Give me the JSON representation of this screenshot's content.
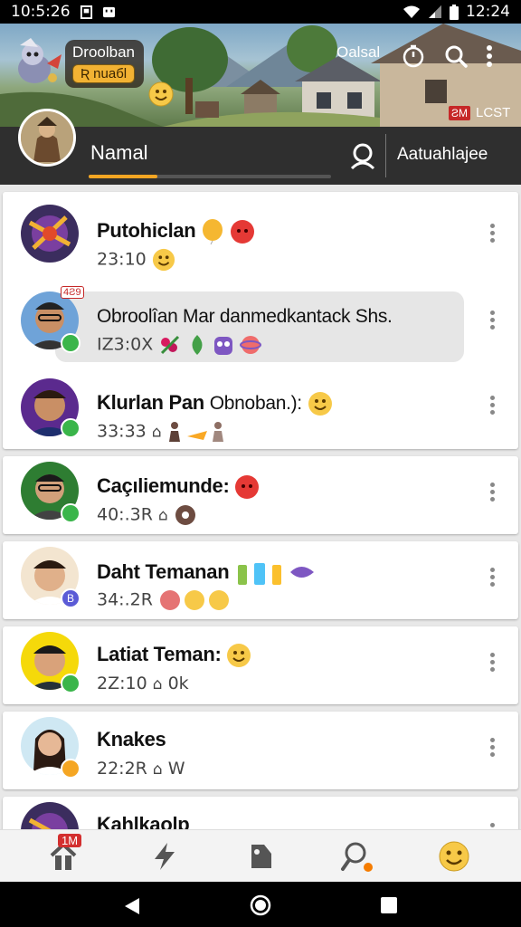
{
  "status_bar": {
    "time": "10:5:26",
    "clock": "12:24"
  },
  "header": {
    "profile_name": "Droolban",
    "profile_badge": "Ʀ nuaбl",
    "action_label": "Oalsal",
    "corner_badge_icon": "ƧM",
    "corner_badge_text": "LCST"
  },
  "tabs": {
    "active_label": "Namal",
    "second_label": "Aatuahlajee"
  },
  "chats": [
    {
      "name": "Putohiclan",
      "sub": "23:10",
      "status": "none",
      "status_color": "#000000"
    },
    {
      "name": "Obroolîan Mar danmedkantack Shs.",
      "sub": "IZ3:0X",
      "status": "online",
      "status_color": "#3ab54a",
      "corner_tag": "4Ƨ9"
    },
    {
      "name": "Klurlan Pan",
      "name_extra": "Obnoban.):",
      "sub": "33:33",
      "status": "online",
      "status_color": "#3ab54a"
    },
    {
      "name": "Caçıliemunde:",
      "sub": "40:.3R",
      "status": "online",
      "status_color": "#3ab54a"
    },
    {
      "name": "Daht Temanan",
      "sub": "34:.2R",
      "status": "alt",
      "status_color": "#5b5bd6",
      "status_letter": "B"
    },
    {
      "name": "Latiat Teman:",
      "sub": "2Z:10",
      "sub_extra": "0k",
      "status": "online",
      "status_color": "#3ab54a"
    },
    {
      "name": "Knakes",
      "sub": "22:2R",
      "sub_extra": "W",
      "status": "away",
      "status_color": "#f5a623"
    },
    {
      "name": "Kahlkaolp",
      "sub": "",
      "status": "none",
      "status_color": "#000000"
    }
  ],
  "bottom_nav": {
    "badge": "1M",
    "items": [
      "home-icon",
      "lightning-icon",
      "tag-icon",
      "search-icon",
      "emoji-icon"
    ],
    "search_dot_color": "#f57c00"
  },
  "colors": {
    "accent": "#f5a623",
    "online": "#3ab54a",
    "tabbar": "#2f2f2f"
  }
}
